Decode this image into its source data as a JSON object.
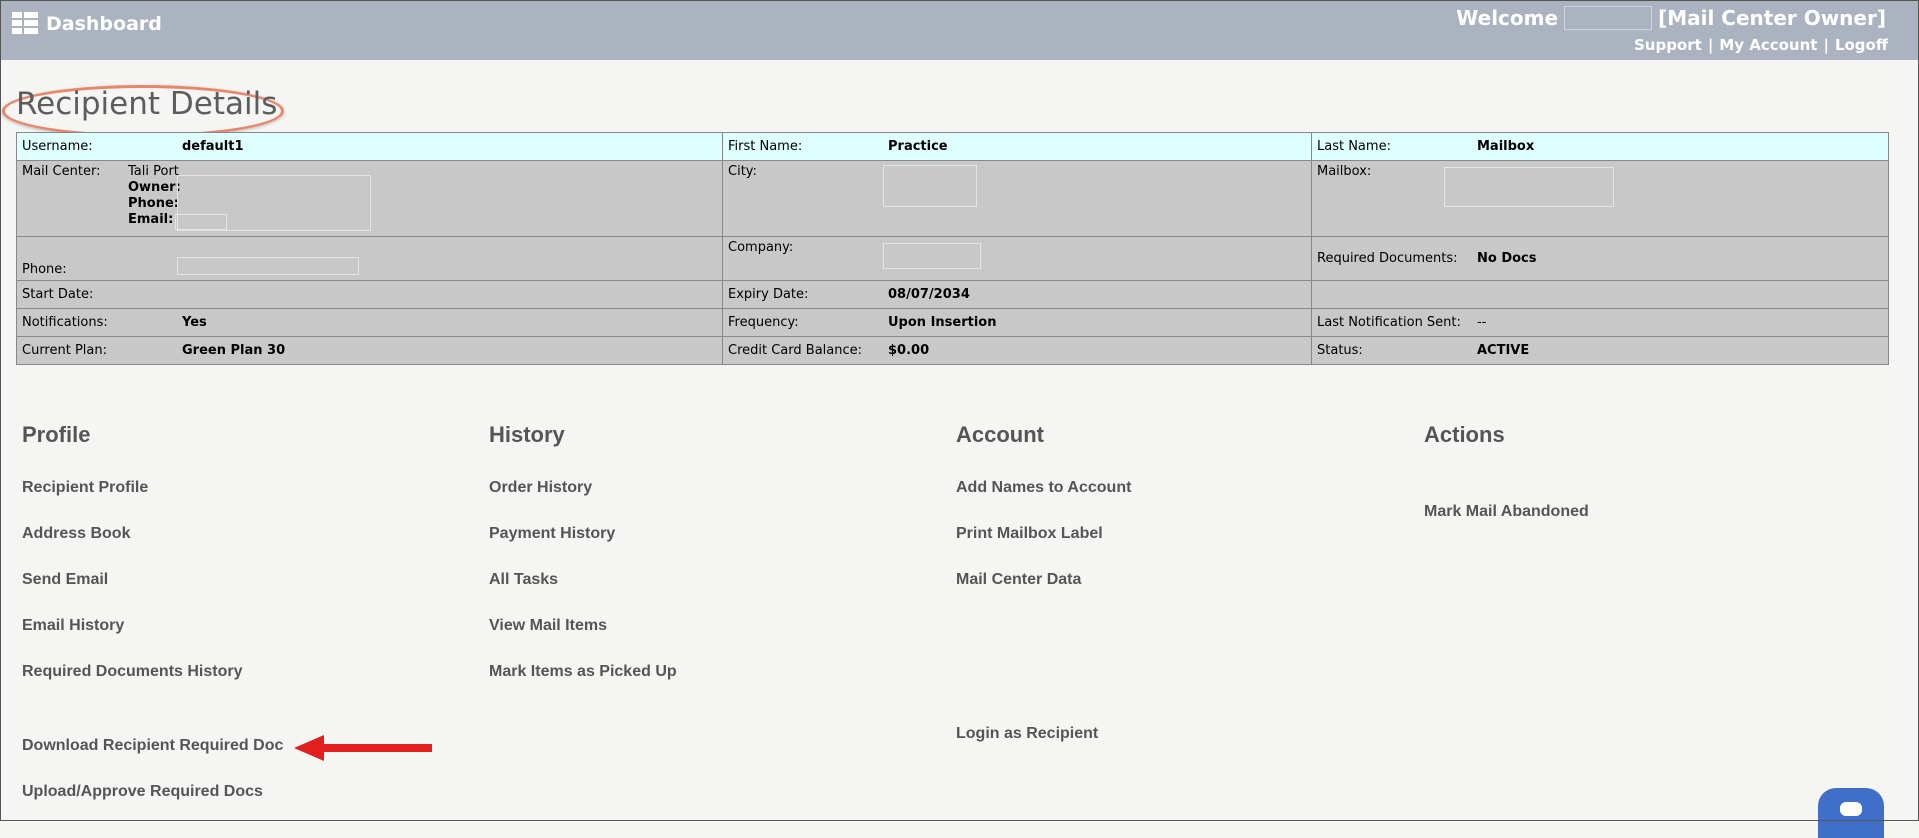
{
  "header": {
    "brand": "Dashboard",
    "welcome": "Welcome",
    "role": "[Mail Center Owner]",
    "links": [
      "Support",
      "My Account",
      "Logoff"
    ]
  },
  "page_title": "Recipient Details",
  "details": {
    "username_label": "Username:",
    "username": "default1",
    "first_name_label": "First Name:",
    "first_name": "Practice",
    "last_name_label": "Last Name:",
    "last_name": "Mailbox",
    "mail_center_label": "Mail Center:",
    "mail_center_name": "Tali Port",
    "mail_center_owner_label": "Owner:",
    "mail_center_phone_label": "Phone:",
    "mail_center_email_label": "Email:",
    "city_label": "City:",
    "mailbox_label": "Mailbox:",
    "phone_label": "Phone:",
    "company_label": "Company:",
    "required_docs_label": "Required Documents:",
    "required_docs": "No Docs",
    "start_date_label": "Start Date:",
    "expiry_date_label": "Expiry Date:",
    "expiry_date": "08/07/2034",
    "notifications_label": "Notifications:",
    "notifications": "Yes",
    "frequency_label": "Frequency:",
    "frequency": "Upon Insertion",
    "last_notification_label": "Last Notification Sent:",
    "last_notification": "--",
    "current_plan_label": "Current Plan:",
    "current_plan": "Green Plan 30",
    "cc_balance_label": "Credit Card Balance:",
    "cc_balance": "$0.00",
    "status_label": "Status:",
    "status": "ACTIVE"
  },
  "sections": {
    "profile": {
      "heading": "Profile",
      "links": [
        "Recipient Profile",
        "Address Book",
        "Send Email",
        "Email History",
        "Required Documents History",
        "Download Recipient Required Doc",
        "Upload/Approve Required Docs"
      ]
    },
    "history": {
      "heading": "History",
      "links": [
        "Order History",
        "Payment History",
        "All Tasks",
        "View Mail Items",
        "Mark Items as Picked Up"
      ]
    },
    "account": {
      "heading": "Account",
      "links": [
        "Add Names to Account",
        "Print Mailbox Label",
        "Mail Center Data",
        "Login as Recipient"
      ]
    },
    "actions": {
      "heading": "Actions",
      "links": [
        "Mark Mail Abandoned"
      ]
    }
  },
  "colors": {
    "header_bg": "#abb2c0",
    "highlight_row": "#dfffff",
    "gray_row": "#c8c8c8",
    "annotation": "#e8866a",
    "arrow": "#e31e1e",
    "chat": "#3f6fc8"
  },
  "icons": [
    "grid-icon",
    "arrow-annotation-icon",
    "chat-icon"
  ]
}
